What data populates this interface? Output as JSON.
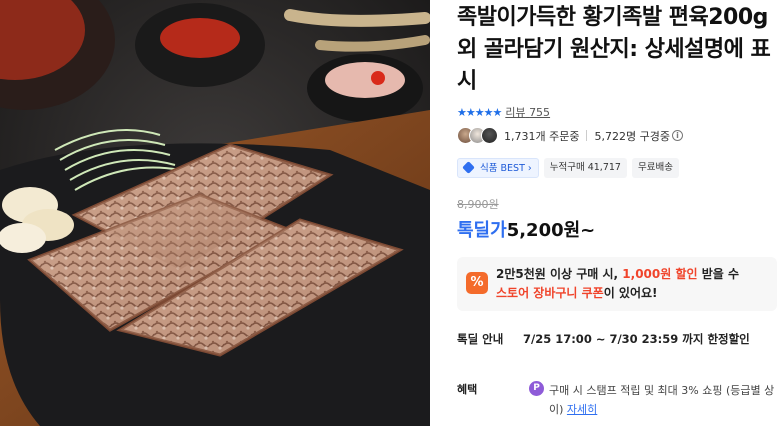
{
  "product": {
    "title": "족발이가득한 황기족발 편육200g 외 골라담기 원산지: 상세설명에 표시",
    "stars": "★★★★★",
    "review_label": "리뷰",
    "review_count": "755",
    "orders": "1,731개 주문중",
    "subscribers": "5,722명 구경중",
    "info_icon_glyph": "i",
    "badges": {
      "best": "식품 BEST",
      "best_chevron": "›",
      "cumulative": "누적구매 41,717",
      "shipping": "무료배송"
    },
    "original_price": "8,900원",
    "price_label": "톡딜가",
    "price": "5,200원~",
    "coupon": {
      "icon": "%",
      "line1_pre": "2만5천원 이상 구매 시, ",
      "line1_hl": "1,000원 할인",
      "line1_post": " 받을 수",
      "line2_pre": "스토어 장바구니 쿠폰",
      "line2_post": "이 있어요!"
    },
    "sale": {
      "label": "톡딜 안내",
      "text": "7/25 17:00 ~ 7/30 23:59 까지 한정할인"
    },
    "benefit": {
      "label": "혜택",
      "icon": "P",
      "text": "구매 시 스탬프 적립 및 최대 3% 쇼핑 (등급별 상이) ",
      "link": "자세히"
    }
  },
  "colors": {
    "accent_blue": "#2f6ff0",
    "discount_red": "#f0442b",
    "coupon_orange": "#f46b2b",
    "point_purple": "#8e5bd8"
  }
}
